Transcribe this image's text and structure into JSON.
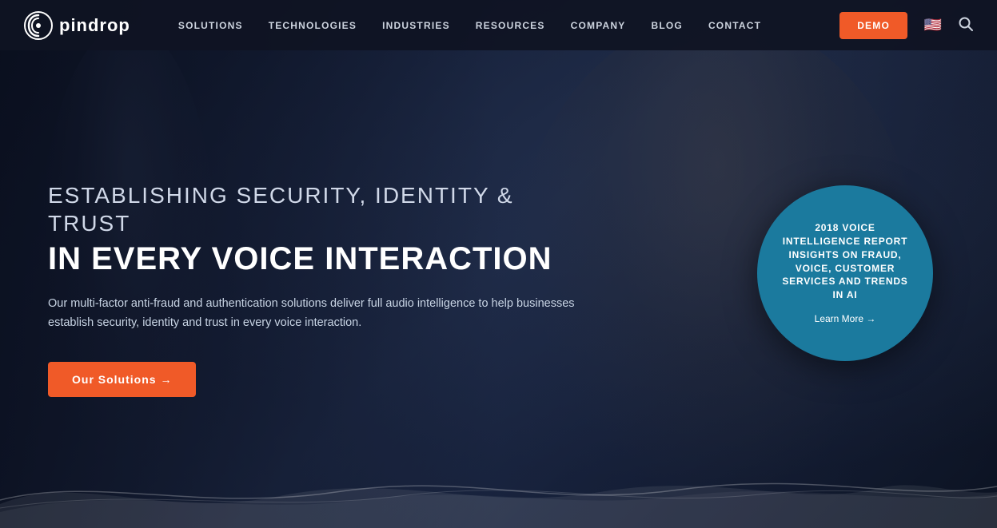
{
  "nav": {
    "logo_text": "pindrop",
    "links": [
      {
        "label": "SOLUTIONS",
        "id": "solutions"
      },
      {
        "label": "TECHNOLOGIES",
        "id": "technologies"
      },
      {
        "label": "INDUSTRIES",
        "id": "industries"
      },
      {
        "label": "RESOURCES",
        "id": "resources"
      },
      {
        "label": "COMPANY",
        "id": "company"
      },
      {
        "label": "BLOG",
        "id": "blog"
      },
      {
        "label": "CONTACT",
        "id": "contact"
      }
    ],
    "demo_button": "DEMO",
    "flag_emoji": "🇺🇸"
  },
  "hero": {
    "eyebrow_line1": "ESTABLISHING SECURITY, IDENTITY &",
    "eyebrow_line2": "TRUST",
    "title_bold": "IN EVERY VOICE INTERACTION",
    "description": "Our multi-factor anti-fraud and authentication solutions deliver full audio intelligence to help businesses establish security, identity and trust in every voice interaction.",
    "cta_label": "Our Solutions  →"
  },
  "circle_card": {
    "title": "2018 VOICE INTELLIGENCE REPORT INSIGHTS ON FRAUD, VOICE, CUSTOMER SERVICES AND TRENDS IN AI",
    "learn_more": "Learn More →"
  },
  "colors": {
    "accent_orange": "#f05a28",
    "circle_teal": "#1b7a9e",
    "nav_bg": "rgba(15,20,35,0.92)"
  }
}
